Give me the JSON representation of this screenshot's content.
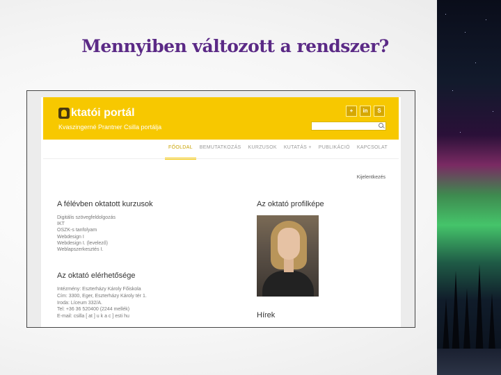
{
  "slide": {
    "title": "Mennyiben változott a rendszer?"
  },
  "portal": {
    "title": "ktatói portál",
    "subtitle": "Kvaszingerné Prantner Csilla portálja",
    "social": [
      "plus-icon",
      "linkedin-icon",
      "skype-icon"
    ],
    "social_labels": [
      "+",
      "in",
      "S"
    ],
    "search": {
      "placeholder": "",
      "value": ""
    },
    "nav": [
      {
        "label": "FŐOLDAL",
        "active": true
      },
      {
        "label": "BEMUTATKOZÁS",
        "active": false
      },
      {
        "label": "KURZUSOK",
        "active": false
      },
      {
        "label": "KUTATÁS +",
        "active": false
      },
      {
        "label": "PUBLIKÁCIÓ",
        "active": false
      },
      {
        "label": "KAPCSOLAT",
        "active": false
      }
    ],
    "logout": "Kijelentkezés",
    "courses_heading": "A félévben oktatott kurzusok",
    "courses": [
      "Digitális szövegfeldolgozás",
      "IKT",
      "OSZK-s tanfolyam",
      "Webdesign I",
      "Webdesign I. (levelező)",
      "Weblapszerkesztés I."
    ],
    "contact_heading": "Az oktató elérhetősége",
    "contact": [
      "Intézmény: Eszterházy Károly Főiskola",
      "Cím: 3300, Eger, Eszterházy Károly tér 1.",
      "Iroda: Líceum 332/A.",
      "Tel: +36 36 520400 (2244 mellék)",
      "E-mail: csilla [ at ] u k a c ] esti hu"
    ],
    "photo_heading": "Az oktató profilképe",
    "news_heading": "Hírek"
  },
  "colors": {
    "header": "#f7c800",
    "title": "#5b2a86"
  }
}
